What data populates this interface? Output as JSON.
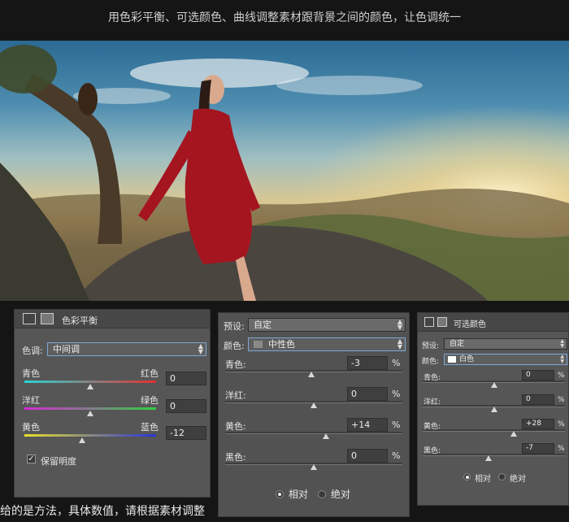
{
  "header": {
    "title": "用色彩平衡、可选颜色、曲线调整素材跟背景之间的颜色，让色调统一"
  },
  "color_balance": {
    "panel_title": "色彩平衡",
    "tone_label": "色调:",
    "tone_value": "中间调",
    "sliders": [
      {
        "left": "青色",
        "right": "红色",
        "value": "0",
        "level": 0
      },
      {
        "left": "洋红",
        "right": "绿色",
        "value": "0",
        "level": 0
      },
      {
        "left": "黄色",
        "right": "蓝色",
        "value": "-12",
        "level": -12
      }
    ],
    "preserve_label": "保留明度",
    "preserve_checked": true
  },
  "selective_color_large": {
    "preset_label": "预设:",
    "preset_value": "自定",
    "color_label": "颜色:",
    "color_value": "中性色",
    "rows": [
      {
        "label": "青色:",
        "value": "-3",
        "level": -3
      },
      {
        "label": "洋红:",
        "value": "0",
        "level": 0
      },
      {
        "label": "黄色:",
        "value": "+14",
        "level": 14
      },
      {
        "label": "黑色:",
        "value": "0",
        "level": 0
      }
    ],
    "percent": "%",
    "radio_relative": "相对",
    "radio_absolute": "绝对",
    "selected": "relative"
  },
  "selective_color_small": {
    "panel_title": "可选颜色",
    "preset_label": "预设:",
    "preset_value": "自定",
    "color_label": "颜色:",
    "color_value": "白色",
    "rows": [
      {
        "label": "青色:",
        "value": "0",
        "level": 0
      },
      {
        "label": "洋红:",
        "value": "0",
        "level": 0
      },
      {
        "label": "黄色:",
        "value": "+28",
        "level": 28
      },
      {
        "label": "黑色:",
        "value": "-7",
        "level": -7
      }
    ],
    "percent": "%",
    "radio_relative": "相对",
    "radio_absolute": "绝对",
    "selected": "relative"
  },
  "footer": {
    "note": "给的是方法，具体数值，请根据素材调整"
  }
}
